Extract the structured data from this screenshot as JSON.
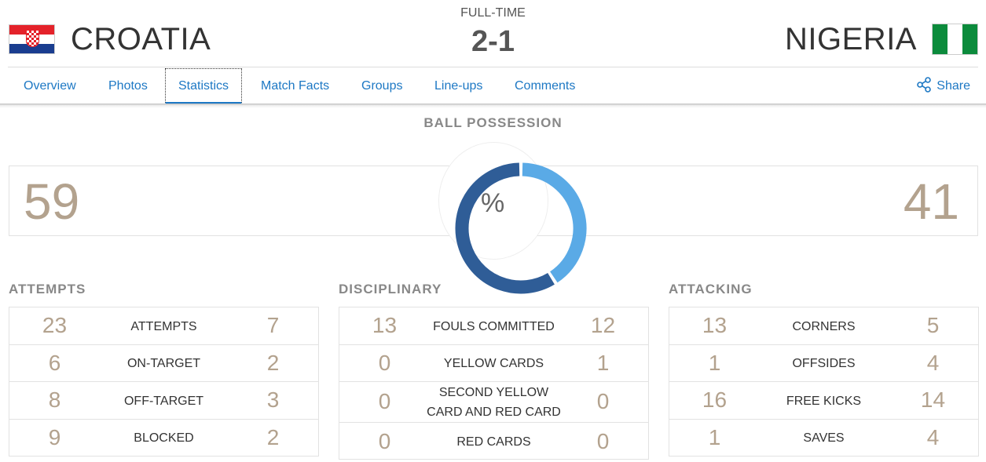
{
  "match": {
    "status": "FULL-TIME",
    "score": "2-1",
    "home_team": "CROATIA",
    "away_team": "NIGERIA",
    "home_flag_icon": "croatia-flag-icon",
    "away_flag_icon": "nigeria-flag-icon"
  },
  "nav": {
    "tabs": [
      "Overview",
      "Photos",
      "Statistics",
      "Match Facts",
      "Groups",
      "Line-ups",
      "Comments"
    ],
    "active_tab": "Statistics",
    "share_label": "Share",
    "share_icon": "share-icon"
  },
  "possession": {
    "title": "BALL POSSESSION",
    "home": "59",
    "away": "41",
    "unit": "%",
    "home_color": "#2f5d97",
    "away_color": "#5aaae6"
  },
  "attempts": {
    "title": "ATTEMPTS",
    "rows": [
      {
        "label": "ATTEMPTS",
        "home": "23",
        "away": "7"
      },
      {
        "label": "ON-TARGET",
        "home": "6",
        "away": "2"
      },
      {
        "label": "OFF-TARGET",
        "home": "8",
        "away": "3"
      },
      {
        "label": "BLOCKED",
        "home": "9",
        "away": "2"
      }
    ]
  },
  "disciplinary": {
    "title": "DISCIPLINARY",
    "rows": [
      {
        "label": "FOULS COMMITTED",
        "home": "13",
        "away": "12"
      },
      {
        "label": "YELLOW CARDS",
        "home": "0",
        "away": "1"
      },
      {
        "label": "SECOND YELLOW CARD AND RED CARD",
        "home": "0",
        "away": "0"
      },
      {
        "label": "RED CARDS",
        "home": "0",
        "away": "0"
      }
    ]
  },
  "attacking": {
    "title": "ATTACKING",
    "rows": [
      {
        "label": "CORNERS",
        "home": "13",
        "away": "5"
      },
      {
        "label": "OFFSIDES",
        "home": "1",
        "away": "4"
      },
      {
        "label": "FREE KICKS",
        "home": "16",
        "away": "14"
      },
      {
        "label": "SAVES",
        "home": "1",
        "away": "4"
      }
    ]
  }
}
